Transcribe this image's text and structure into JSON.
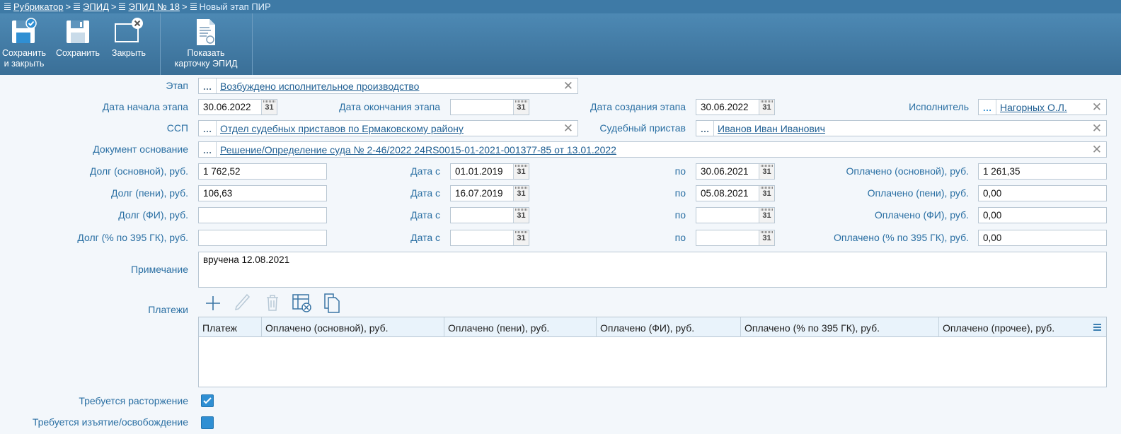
{
  "breadcrumb": {
    "items": [
      "Рубрикатор",
      "ЭПИД",
      "ЭПИД № 18"
    ],
    "separator": ">",
    "current": "Новый этап ПИР"
  },
  "toolbar": {
    "save_close": "Сохранить\nи закрыть",
    "save": "Сохранить",
    "close": "Закрыть",
    "show_card": "Показать\nкарточку ЭПИД"
  },
  "form": {
    "stage_label": "Этап",
    "stage_value": "Возбуждено исполнительное производство",
    "start_date_label": "Дата начала этапа",
    "start_date_value": "30.06.2022",
    "end_date_label": "Дата окончания этапа",
    "end_date_value": "",
    "created_date_label": "Дата создания этапа",
    "created_date_value": "30.06.2022",
    "executor_label": "Исполнитель",
    "executor_value": "Нагорных О.Л.",
    "ssp_label": "ССП",
    "ssp_value": "Отдел судебных приставов по Ермаковскому району",
    "bailiff_label": "Судебный пристав",
    "bailiff_value": "Иванов Иван Иванович",
    "doc_label": "Документ основание",
    "doc_value": "Решение/Определение суда № 2-46/2022 24RS0015-01-2021-001377-85 от 13.01.2022",
    "date_from_label": "Дата с",
    "date_to_label": "по",
    "debt_rows": [
      {
        "label": "Долг (основной), руб.",
        "value": "1 762,52",
        "from": "01.01.2019",
        "to": "30.06.2021",
        "paid_label": "Оплачено (основной), руб.",
        "paid": "1 261,35"
      },
      {
        "label": "Долг (пени), руб.",
        "value": "106,63",
        "from": "16.07.2019",
        "to": "05.08.2021",
        "paid_label": "Оплачено (пени), руб.",
        "paid": "0,00"
      },
      {
        "label": "Долг (ФИ), руб.",
        "value": "",
        "from": "",
        "to": "",
        "paid_label": "Оплачено (ФИ), руб.",
        "paid": "0,00"
      },
      {
        "label": "Долг (% по 395 ГК), руб.",
        "value": "",
        "from": "",
        "to": "",
        "paid_label": "Оплачено (% по 395 ГК), руб.",
        "paid": "0,00"
      }
    ],
    "note_label": "Примечание",
    "note_value": "вручена 12.08.2021",
    "payments_label": "Платежи",
    "payments_columns": [
      "Платеж",
      "Оплачено (основной), руб.",
      "Оплачено (пени), руб.",
      "Оплачено (ФИ), руб.",
      "Оплачено (% по 395 ГК), руб.",
      "Оплачено (прочее), руб."
    ],
    "termination_label": "Требуется расторжение",
    "seizure_label": "Требуется изъятие/освобождение"
  },
  "calendar_glyph": "31",
  "colors": {
    "accent": "#3e7aa6",
    "label": "#2a6fa3",
    "link": "#1f5f93"
  }
}
